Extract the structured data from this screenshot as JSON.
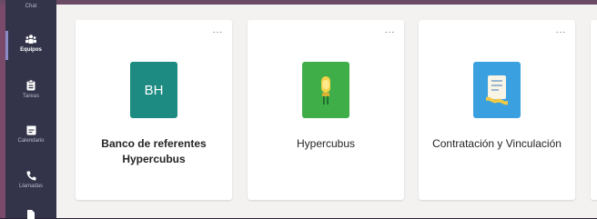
{
  "rail": {
    "items": [
      {
        "label": "Chat",
        "icon": "chat-icon"
      },
      {
        "label": "Equipos",
        "icon": "teams-icon",
        "active": true
      },
      {
        "label": "Tareas",
        "icon": "assignments-icon"
      },
      {
        "label": "Calendario",
        "icon": "calendar-icon"
      },
      {
        "label": "Llamadas",
        "icon": "calls-icon"
      },
      {
        "label": "",
        "icon": "files-icon"
      }
    ]
  },
  "teams": [
    {
      "name": "Banco de referentes Hypercubus",
      "initials": "BH",
      "tile_color": "#1e8b82",
      "icon": "team-initials-avatar",
      "more": "···"
    },
    {
      "name": "Hypercubus",
      "tile_color": "#3fae49",
      "icon": "lightbulb-icon",
      "more": "···"
    },
    {
      "name": "Contratación y Vinculación",
      "tile_color": "#3aa0e0",
      "icon": "certificate-icon",
      "more": "···"
    }
  ],
  "colors": {
    "rail_bg": "#33344a",
    "main_bg": "#f3f2f1",
    "accent": "#8b8cc7"
  }
}
